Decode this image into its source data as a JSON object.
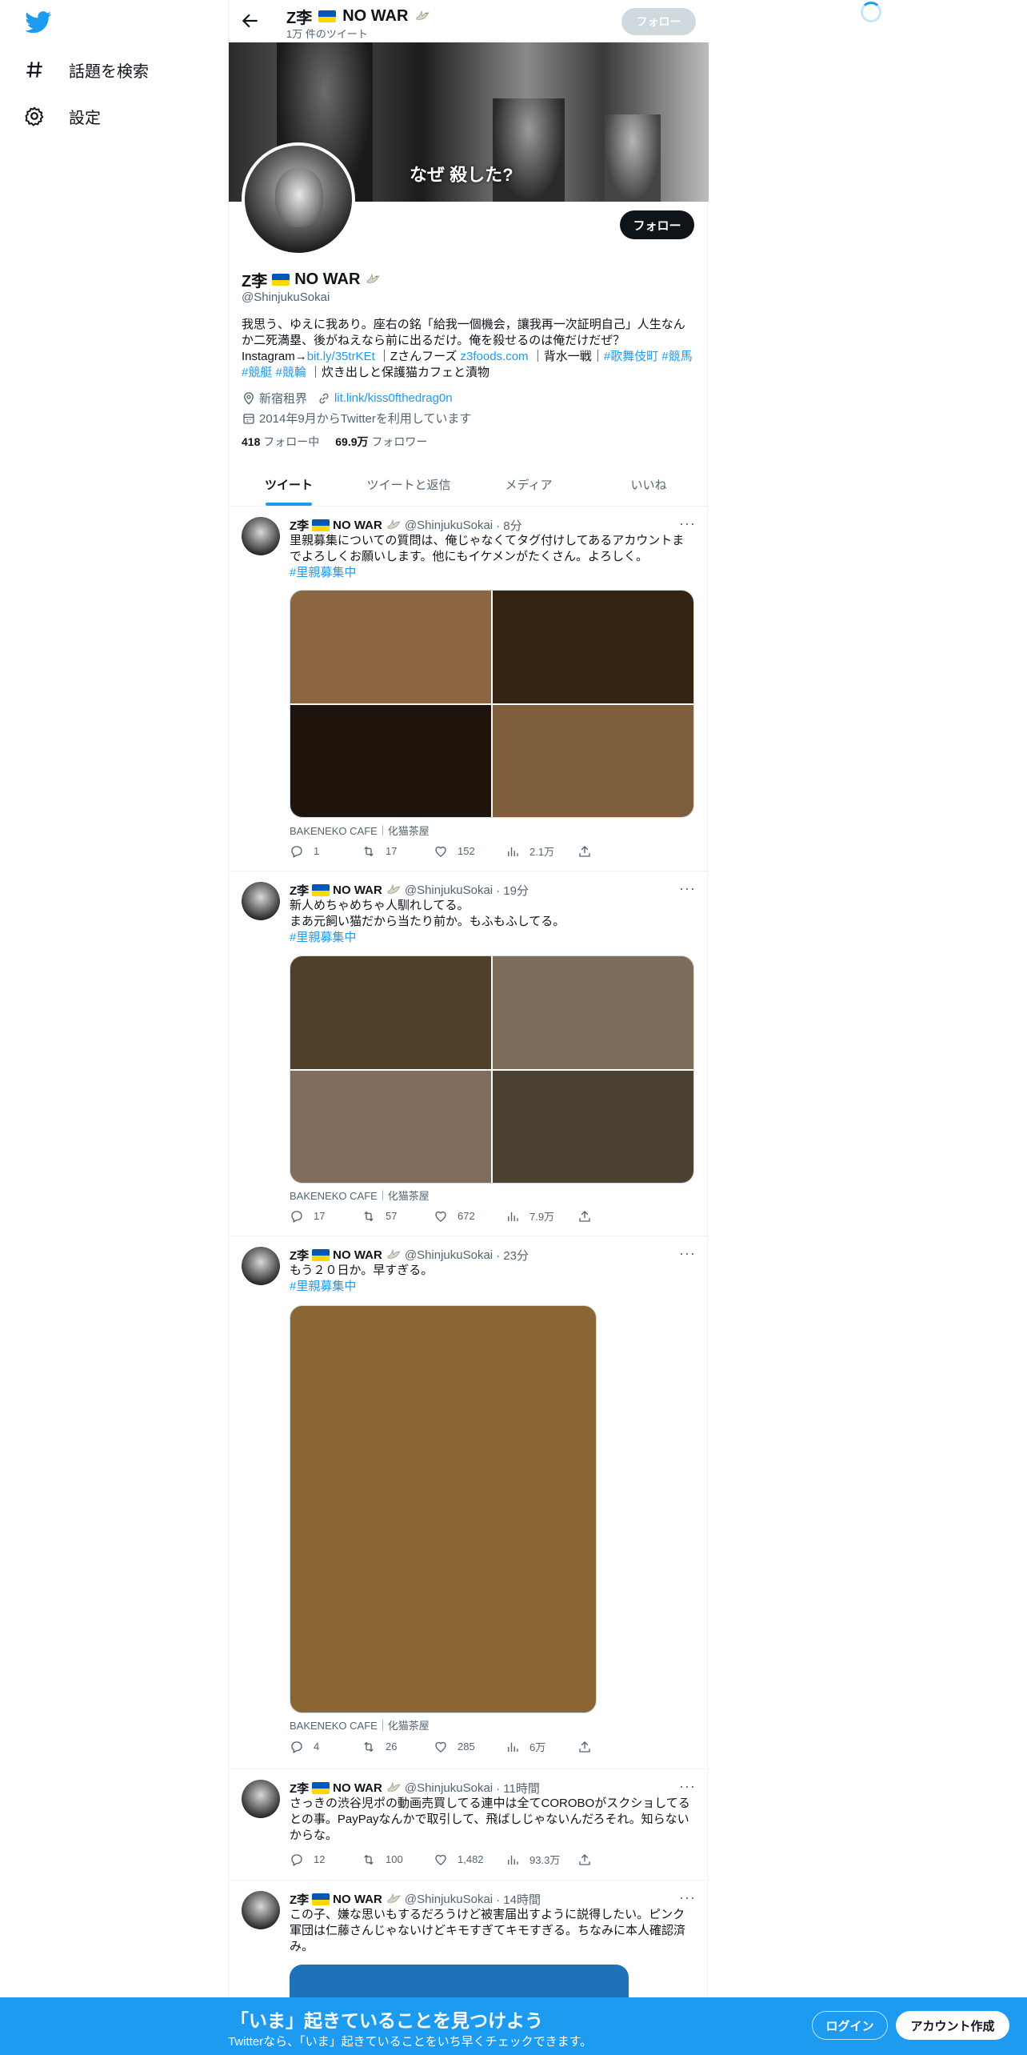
{
  "nav": {
    "explore_label": "話題を検索",
    "settings_label": "設定"
  },
  "header": {
    "name": "Z李",
    "name_suffix": "NO WAR",
    "tweet_count": "1万 件のツイート",
    "follow_label": "フォロー"
  },
  "banner": {
    "caption": "なぜ 殺した?"
  },
  "profile": {
    "follow_label": "フォロー",
    "name": "Z李",
    "name_suffix": "NO WAR",
    "handle": "@ShinjukuSokai",
    "bio_line1": "我思う、ゆえに我あり。座右の銘「給我一個機会，讓我再一次証明自己」人生なんか二死満塁、後がねえなら前に出るだけ。俺を殺せるのは俺だけだぜ？",
    "bio_ig_prefix": "Instagram→",
    "bio_ig_link": "bit.ly/35trKEt",
    "bio_mid": "｜Zさんフーズ",
    "bio_foods_link": "z3foods.com",
    "bio_mid2": "｜背水一戦｜",
    "bio_tag1": "#歌舞伎町",
    "bio_tag2": "#競馬",
    "bio_tag3": "#競艇",
    "bio_tag4": "#競輪",
    "bio_tail": "｜炊き出しと保護猫カフェと漬物",
    "location": "新宿租界",
    "url": "lit.link/kiss0fthedrag0n",
    "joined": "2014年9月からTwitterを利用しています",
    "following_count": "418",
    "following_label": "フォロー中",
    "followers_count": "69.9万",
    "followers_label": "フォロワー"
  },
  "tabs": [
    "ツイート",
    "ツイートと返信",
    "メディア",
    "いいね"
  ],
  "tweets": [
    {
      "name": "Z李",
      "name_suffix": "NO WAR",
      "handle": "@ShinjukuSokai",
      "time": "· 8分",
      "lines": [
        "里親募集についての質問は、俺じゃなくてタグ付けしてあるアカウントまでよろしくお願いします。他にもイケメンがたくさん。よろしく。"
      ],
      "tag": "#里親募集中",
      "media_colors": [
        "#8b6640",
        "#332414",
        "#1f140c",
        "#7e5e3d"
      ],
      "source": "BAKENEKO CAFE｜化猫茶屋",
      "replies": "1",
      "retweets": "17",
      "likes": "152",
      "views": "2.1万"
    },
    {
      "name": "Z李",
      "name_suffix": "NO WAR",
      "handle": "@ShinjukuSokai",
      "time": "· 19分",
      "lines": [
        "新人めちゃめちゃ人馴れしてる。",
        "まあ元飼い猫だから当たり前か。もふもふしてる。"
      ],
      "tag": "#里親募集中",
      "media_colors": [
        "#4f4029",
        "#7e6d5b",
        "#826d5c",
        "#4c4233"
      ],
      "source": "BAKENEKO CAFE｜化猫茶屋",
      "replies": "17",
      "retweets": "57",
      "likes": "672",
      "views": "7.9万"
    },
    {
      "name": "Z李",
      "name_suffix": "NO WAR",
      "handle": "@ShinjukuSokai",
      "time": "· 23分",
      "lines": [
        "もう２０日か。早すぎる。"
      ],
      "tag": "#里親募集中",
      "media_colors": [
        "#8b6634"
      ],
      "source": "BAKENEKO CAFE｜化猫茶屋",
      "replies": "4",
      "retweets": "26",
      "likes": "285",
      "views": "6万"
    },
    {
      "name": "Z李",
      "name_suffix": "NO WAR",
      "handle": "@ShinjukuSokai",
      "time": "· 11時間",
      "lines": [
        "さっきの渋谷児ポの動画売買してる連中は全てCOROBOがスクショしてるとの事。PayPayなんかで取引して、飛ばしじゃないんだろそれ。知らないからな。"
      ],
      "tag": "",
      "media_colors": [],
      "source": "",
      "replies": "12",
      "retweets": "100",
      "likes": "1,482",
      "views": "93.3万"
    },
    {
      "name": "Z李",
      "name_suffix": "NO WAR",
      "handle": "@ShinjukuSokai",
      "time": "· 14時間",
      "lines": [
        "この子、嫌な思いもするだろうけど被害届出すように説得したい。ピンク軍団は仁藤さんじゃないけどキモすぎてキモすぎる。ちなみに本人確認済み。"
      ],
      "tag": "",
      "media_colors": [
        "#1d72b8"
      ],
      "source": "",
      "replies": "",
      "retweets": "",
      "likes": "",
      "views": ""
    }
  ],
  "bottom": {
    "title": "「いま」起きていることを見つけよう",
    "subtitle": "Twitterなら、「いま」起きていることをいち早くチェックできます。",
    "login_label": "ログイン",
    "signup_label": "アカウント作成"
  },
  "colors": {
    "accent": "#1d9bf0",
    "text": "#0f1419",
    "secondary": "#536471",
    "flag_blue": "#0057b7",
    "flag_yellow": "#ffd700"
  },
  "icons": [
    "twitter-logo-icon",
    "hashtag-icon",
    "gear-icon",
    "back-arrow-icon",
    "location-icon",
    "link-icon",
    "calendar-icon",
    "reply-icon",
    "retweet-icon",
    "like-icon",
    "views-icon",
    "share-icon",
    "more-icon"
  ]
}
